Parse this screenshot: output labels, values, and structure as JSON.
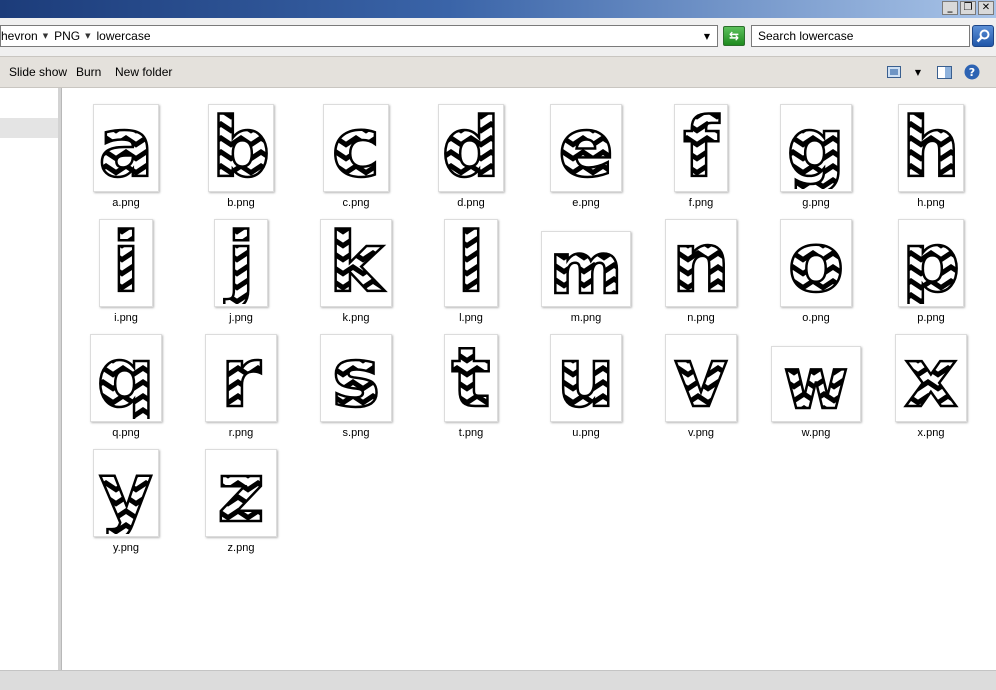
{
  "breadcrumb": [
    {
      "label": "hevron"
    },
    {
      "label": "PNG"
    },
    {
      "label": "lowercase"
    }
  ],
  "search": {
    "placeholder": "Search lowercase"
  },
  "toolbar": {
    "slideshow": "Slide show",
    "burn": "Burn",
    "new_folder": "New folder"
  },
  "files": [
    {
      "name": "a.png",
      "letter": "a"
    },
    {
      "name": "b.png",
      "letter": "b"
    },
    {
      "name": "c.png",
      "letter": "c"
    },
    {
      "name": "d.png",
      "letter": "d"
    },
    {
      "name": "e.png",
      "letter": "e"
    },
    {
      "name": "f.png",
      "letter": "f"
    },
    {
      "name": "g.png",
      "letter": "g"
    },
    {
      "name": "h.png",
      "letter": "h"
    },
    {
      "name": "i.png",
      "letter": "i"
    },
    {
      "name": "j.png",
      "letter": "j"
    },
    {
      "name": "k.png",
      "letter": "k"
    },
    {
      "name": "l.png",
      "letter": "l"
    },
    {
      "name": "m.png",
      "letter": "m"
    },
    {
      "name": "n.png",
      "letter": "n"
    },
    {
      "name": "o.png",
      "letter": "o"
    },
    {
      "name": "p.png",
      "letter": "p"
    },
    {
      "name": "q.png",
      "letter": "q"
    },
    {
      "name": "r.png",
      "letter": "r"
    },
    {
      "name": "s.png",
      "letter": "s"
    },
    {
      "name": "t.png",
      "letter": "t"
    },
    {
      "name": "u.png",
      "letter": "u"
    },
    {
      "name": "v.png",
      "letter": "v"
    },
    {
      "name": "w.png",
      "letter": "w"
    },
    {
      "name": "x.png",
      "letter": "x"
    },
    {
      "name": "y.png",
      "letter": "y"
    },
    {
      "name": "z.png",
      "letter": "z"
    }
  ],
  "icons": {
    "minimize": "minimize-icon",
    "restore": "restore-icon",
    "close": "close-icon",
    "refresh": "refresh-icon",
    "search": "search-icon",
    "views": "views-icon",
    "preview_pane": "preview-pane-icon",
    "help": "help-icon"
  }
}
